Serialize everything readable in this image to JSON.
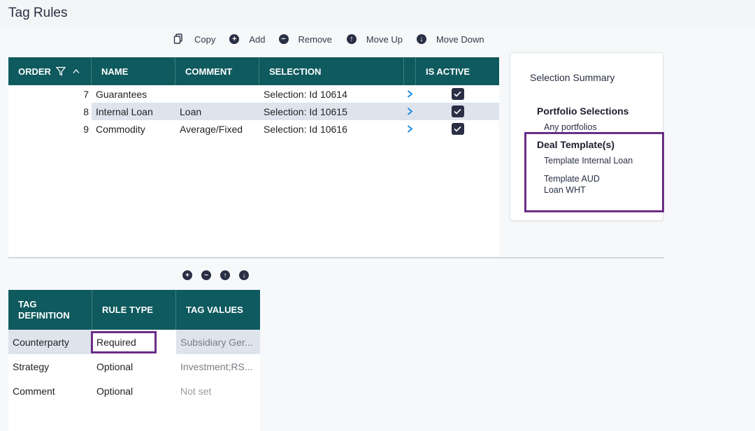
{
  "page_title": "Tag Rules",
  "toolbar": {
    "copy": "Copy",
    "add": "Add",
    "remove": "Remove",
    "move_up": "Move Up",
    "move_down": "Move Down"
  },
  "rules_grid": {
    "headers": {
      "order": "ORDER",
      "name": "NAME",
      "comment": "COMMENT",
      "selection": "SELECTION",
      "is_active": "IS ACTIVE"
    },
    "rows": [
      {
        "order": "7",
        "name": "Guarantees",
        "comment": "",
        "selection": "Selection: Id 10614",
        "active": true
      },
      {
        "order": "8",
        "name": "Internal Loan",
        "comment": "Loan",
        "selection": "Selection: Id 10615",
        "active": true
      },
      {
        "order": "9",
        "name": "Commodity",
        "comment": "Average/Fixed",
        "selection": "Selection: Id 10616",
        "active": true
      }
    ]
  },
  "tag_grid": {
    "headers": {
      "tag_definition_1": "TAG",
      "tag_definition_2": "DEFINITION",
      "rule_type": "RULE TYPE",
      "tag_values": "TAG VALUES"
    },
    "rows": [
      {
        "definition": "Counterparty",
        "rule_type": "Required",
        "values": "Subsidiary Ger..."
      },
      {
        "definition": "Strategy",
        "rule_type": "Optional",
        "values": "Investment;RS..."
      },
      {
        "definition": "Comment",
        "rule_type": "Optional",
        "values": "Not set"
      }
    ]
  },
  "summary": {
    "title": "Selection Summary",
    "portfolio_heading": "Portfolio Selections",
    "portfolio_item": "Any portfolios",
    "deal_heading": "Deal Template(s)",
    "deal_item_1": "Template Internal Loan",
    "deal_item_2a": "Template AUD",
    "deal_item_2b": "Loan WHT"
  },
  "colors": {
    "header_teal": "#0f5a5e",
    "highlight_purple": "#6b2d86",
    "arrow_blue": "#1d8fe6",
    "icon_navy": "#2a2f45"
  }
}
